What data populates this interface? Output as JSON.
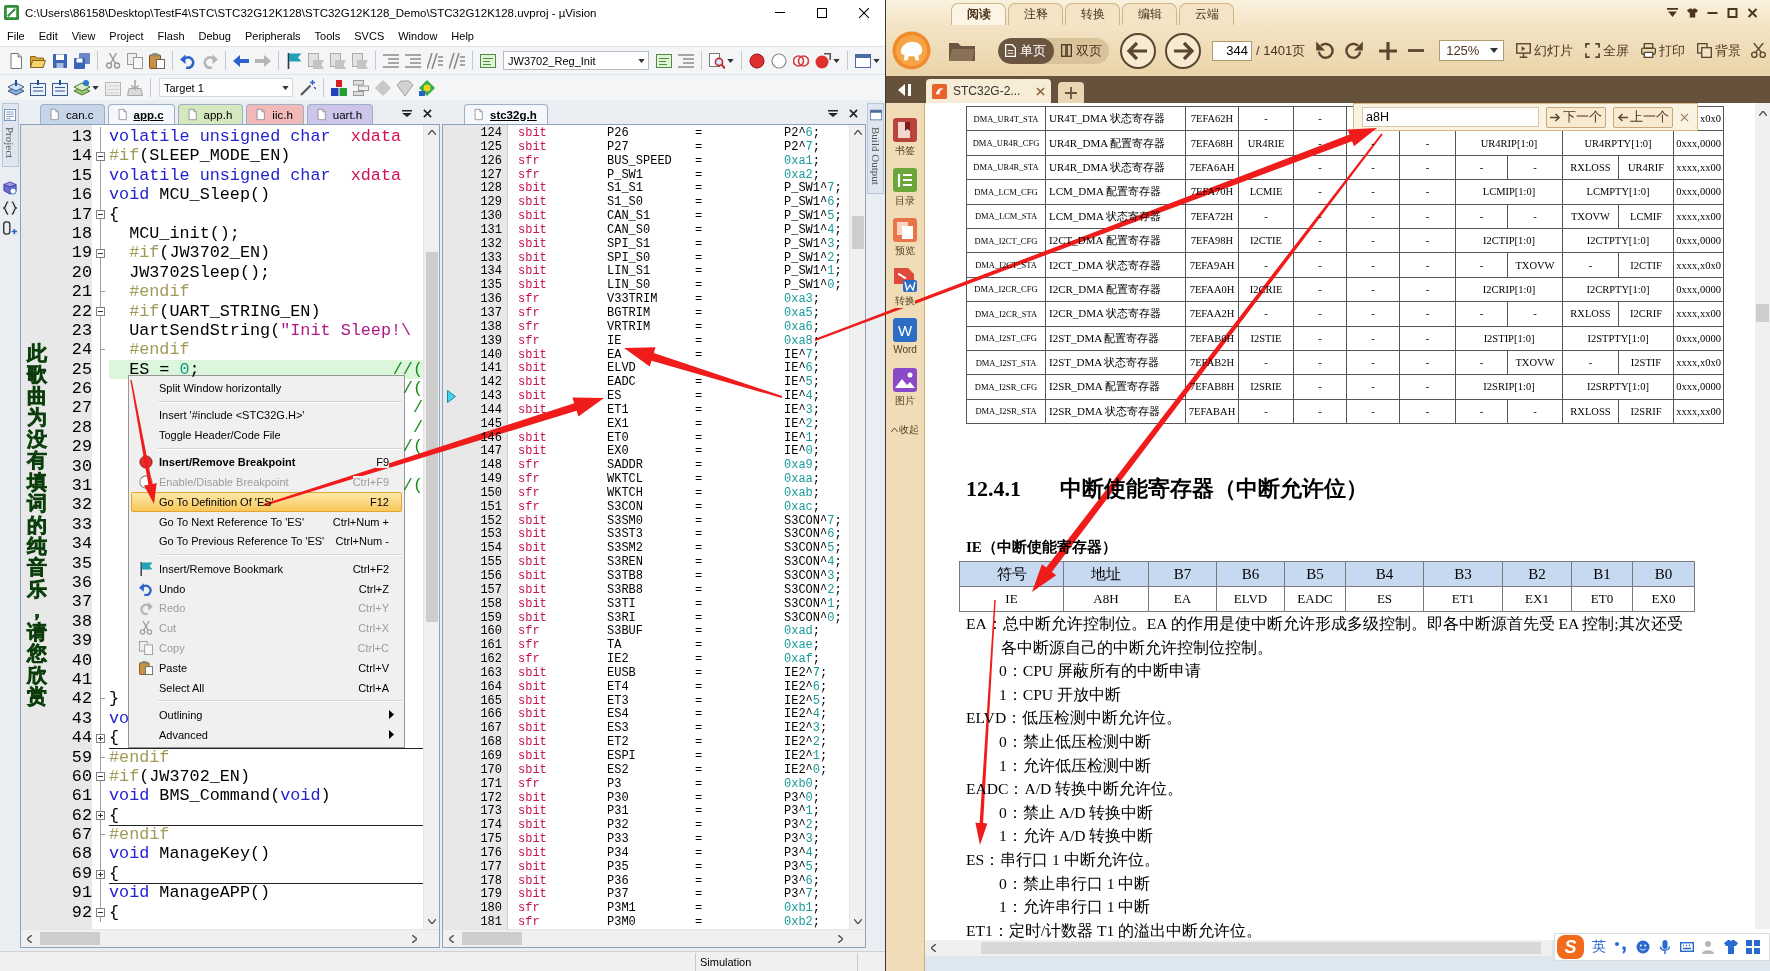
{
  "ide": {
    "title": "C:\\Users\\86158\\Desktop\\TestF4\\STC\\STC32G12K128\\STC32G12K128_Demo\\STC32G12K128.uvproj - µVision",
    "menu": [
      "File",
      "Edit",
      "View",
      "Project",
      "Flash",
      "Debug",
      "Peripherals",
      "Tools",
      "SVCS",
      "Window",
      "Help"
    ],
    "function_combo": "JW3702_Reg_Init",
    "target_combo": "Target 1",
    "project_tab": "Project",
    "build_output_tab": "Build Output",
    "status": "Simulation",
    "editor": {
      "tabs": [
        {
          "label": "can.c",
          "selected": false,
          "color": "#c6d5e8"
        },
        {
          "label": "app.c",
          "selected": true,
          "color": "#f4f7fb"
        },
        {
          "label": "app.h",
          "selected": false,
          "color": "#d3e8bf"
        },
        {
          "label": "iic.h",
          "selected": false,
          "color": "#f2b9b9"
        },
        {
          "label": "uart.h",
          "selected": false,
          "color": "#cdc5ec"
        }
      ],
      "lines": [
        {
          "n": "13",
          "kind": "plain",
          "current": false,
          "code": [
            {
              "kind": "keyword",
              "t": "volatile unsigned char"
            },
            {
              "kind": "storage",
              "t": "  xdata"
            }
          ]
        },
        {
          "n": "14",
          "kind": "fold_open",
          "current": false,
          "code": [
            {
              "kind": "preproc",
              "t": "#if"
            },
            {
              "kind": "plain",
              "t": "(SLEEP_MODE_EN)"
            }
          ]
        },
        {
          "n": "15",
          "kind": "plain",
          "current": false,
          "code": [
            {
              "kind": "keyword",
              "t": "volatile unsigned char"
            },
            {
              "kind": "storage",
              "t": "  xdata"
            }
          ]
        },
        {
          "n": "16",
          "kind": "plain",
          "current": false,
          "code": [
            {
              "kind": "keyword",
              "t": "void"
            },
            {
              "kind": "plain",
              "t": " MCU_Sleep()"
            }
          ]
        },
        {
          "n": "17",
          "kind": "fold_open",
          "current": false,
          "code": [
            {
              "kind": "plain",
              "t": "{"
            }
          ]
        },
        {
          "n": "18",
          "kind": "plain",
          "current": false,
          "code": [
            {
              "kind": "plain",
              "t": "  MCU_init();"
            }
          ]
        },
        {
          "n": "19",
          "kind": "fold_open",
          "current": false,
          "code": [
            {
              "kind": "preproc",
              "t": "  #if"
            },
            {
              "kind": "plain",
              "t": "(JW3702_EN)"
            }
          ]
        },
        {
          "n": "20",
          "kind": "plain",
          "current": false,
          "code": [
            {
              "kind": "plain",
              "t": "  JW3702Sleep();"
            }
          ]
        },
        {
          "n": "21",
          "kind": "fold_end",
          "current": false,
          "code": [
            {
              "kind": "preproc",
              "t": "  #endif"
            }
          ]
        },
        {
          "n": "22",
          "kind": "fold_open",
          "current": false,
          "code": [
            {
              "kind": "preproc",
              "t": "  #if"
            },
            {
              "kind": "plain",
              "t": "(UART_STRING_EN)"
            }
          ]
        },
        {
          "n": "23",
          "kind": "plain",
          "current": false,
          "code": [
            {
              "kind": "plain",
              "t": "  UartSendString("
            },
            {
              "kind": "string",
              "t": "\"Init Sleep!\\"
            }
          ]
        },
        {
          "n": "24",
          "kind": "fold_end",
          "current": false,
          "code": [
            {
              "kind": "preproc",
              "t": "  #endif"
            }
          ]
        },
        {
          "n": "25",
          "kind": "plain",
          "current": true,
          "code": [
            {
              "kind": "plain",
              "t": "  ES = "
            },
            {
              "kind": "number",
              "t": "0"
            },
            {
              "kind": "plain",
              "t": ";"
            }
          ],
          "comment": "//("
        },
        {
          "n": "26",
          "kind": "plain",
          "current": false,
          "comment": "/("
        },
        {
          "n": "27",
          "kind": "plain",
          "current": false,
          "comment": "/"
        },
        {
          "n": "28",
          "kind": "plain",
          "current": false,
          "comment": "/"
        },
        {
          "n": "29",
          "kind": "plain",
          "current": false,
          "comment": "/("
        },
        {
          "n": "30",
          "kind": "plain",
          "current": false
        },
        {
          "n": "31",
          "kind": "plain",
          "current": false,
          "comment": "/("
        },
        {
          "n": "32",
          "kind": "plain",
          "current": false
        },
        {
          "n": "33",
          "kind": "plain",
          "current": false
        },
        {
          "n": "34",
          "kind": "plain",
          "current": false
        },
        {
          "n": "35",
          "kind": "plain",
          "current": false
        },
        {
          "n": "36",
          "kind": "plain",
          "current": false
        },
        {
          "n": "37",
          "kind": "plain",
          "current": false
        },
        {
          "n": "38",
          "kind": "plain",
          "current": false
        },
        {
          "n": "39",
          "kind": "plain",
          "current": false
        },
        {
          "n": "40",
          "kind": "plain",
          "current": false
        },
        {
          "n": "41",
          "kind": "plain",
          "current": false
        },
        {
          "n": "42",
          "kind": "fold_end",
          "current": false,
          "code": [
            {
              "kind": "plain",
              "t": "}"
            }
          ]
        },
        {
          "n": "43",
          "kind": "plain",
          "current": false,
          "code": [
            {
              "kind": "keyword",
              "t": "vo"
            }
          ]
        },
        {
          "n": "44",
          "kind": "fold_closed",
          "current": false,
          "code": [
            {
              "kind": "plain",
              "t": "{"
            }
          ]
        },
        {
          "n": "59",
          "kind": "fold_end",
          "current": false,
          "code": [
            {
              "kind": "preproc",
              "t": "#endif"
            }
          ]
        },
        {
          "n": "60",
          "kind": "fold_open",
          "current": false,
          "code": [
            {
              "kind": "preproc",
              "t": "#if"
            },
            {
              "kind": "plain",
              "t": "(JW3702_EN)"
            }
          ]
        },
        {
          "n": "61",
          "kind": "plain",
          "current": false,
          "code": [
            {
              "kind": "keyword",
              "t": "void"
            },
            {
              "kind": "plain",
              "t": " BMS_Command("
            },
            {
              "kind": "keyword",
              "t": "void"
            },
            {
              "kind": "plain",
              "t": ")"
            }
          ]
        },
        {
          "n": "62",
          "kind": "fold_closed",
          "current": false,
          "code": [
            {
              "kind": "plain",
              "t": "{"
            }
          ]
        },
        {
          "n": "67",
          "kind": "fold_end",
          "current": false,
          "code": [
            {
              "kind": "preproc",
              "t": "#endif"
            }
          ]
        },
        {
          "n": "68",
          "kind": "plain",
          "current": false,
          "code": [
            {
              "kind": "keyword",
              "t": "void"
            },
            {
              "kind": "plain",
              "t": " ManageKey()"
            }
          ]
        },
        {
          "n": "69",
          "kind": "fold_closed",
          "current": false,
          "code": [
            {
              "kind": "plain",
              "t": "{"
            }
          ]
        },
        {
          "n": "91",
          "kind": "plain",
          "current": false,
          "code": [
            {
              "kind": "keyword",
              "t": "void"
            },
            {
              "kind": "plain",
              "t": " ManageAPP()"
            }
          ]
        },
        {
          "n": "92",
          "kind": "fold_open",
          "current": false,
          "code": [
            {
              "kind": "plain",
              "t": "{"
            }
          ]
        }
      ]
    },
    "context_menu": {
      "groups": [
        [
          {
            "label": "Split Window horizontally",
            "disabled": false,
            "selected": false,
            "default": false,
            "submenu": false
          }
        ],
        [
          {
            "label": "Insert '#include <STC32G.H>'",
            "disabled": false,
            "selected": false,
            "default": false,
            "submenu": false
          },
          {
            "label": "Toggle Header/Code File",
            "disabled": false,
            "selected": false,
            "default": false,
            "submenu": false
          }
        ],
        [
          {
            "label": "Insert/Remove Breakpoint",
            "shortcut": "F9",
            "disabled": false,
            "selected": false,
            "default": true,
            "submenu": false
          },
          {
            "label": "Enable/Disable Breakpoint",
            "shortcut": "Ctrl+F9",
            "disabled": true,
            "selected": false,
            "default": false,
            "submenu": false
          },
          {
            "label": "Go To Definition Of 'ES'",
            "shortcut": "F12",
            "disabled": false,
            "selected": true,
            "default": false,
            "submenu": false
          },
          {
            "label": "Go To Next Reference To 'ES'",
            "shortcut": "Ctrl+Num +",
            "disabled": false,
            "selected": false,
            "default": false,
            "submenu": false
          },
          {
            "label": "Go To Previous Reference To 'ES'",
            "shortcut": "Ctrl+Num -",
            "disabled": false,
            "selected": false,
            "default": false,
            "submenu": false
          }
        ],
        [
          {
            "label": "Insert/Remove Bookmark",
            "shortcut": "Ctrl+F2",
            "disabled": false,
            "selected": false,
            "default": false,
            "submenu": false
          },
          {
            "label": "Undo",
            "shortcut": "Ctrl+Z",
            "disabled": false,
            "selected": false,
            "default": false,
            "submenu": false
          },
          {
            "label": "Redo",
            "shortcut": "Ctrl+Y",
            "disabled": true,
            "selected": false,
            "default": false,
            "submenu": false
          },
          {
            "label": "Cut",
            "shortcut": "Ctrl+X",
            "disabled": true,
            "selected": false,
            "default": false,
            "submenu": false
          },
          {
            "label": "Copy",
            "shortcut": "Ctrl+C",
            "disabled": true,
            "selected": false,
            "default": false,
            "submenu": false
          },
          {
            "label": "Paste",
            "shortcut": "Ctrl+V",
            "disabled": false,
            "selected": false,
            "default": false,
            "submenu": false
          },
          {
            "label": "Select All",
            "shortcut": "Ctrl+A",
            "disabled": false,
            "selected": false,
            "default": false,
            "submenu": false
          }
        ],
        [
          {
            "label": "Outlining",
            "disabled": false,
            "selected": false,
            "default": false,
            "submenu": true
          },
          {
            "label": "Advanced",
            "disabled": false,
            "selected": false,
            "default": false,
            "submenu": true
          }
        ]
      ]
    },
    "header_editor": {
      "tabs": [
        {
          "label": "stc32g.h",
          "selected": true
        }
      ],
      "lines": [
        {
          "n": "124",
          "decl": "sbit",
          "name": "P26",
          "op": "=",
          "value": "P2^6;",
          "current": false
        },
        {
          "n": "125",
          "decl": "sbit",
          "name": "P27",
          "op": "=",
          "value": "P2^7;",
          "current": false
        },
        {
          "n": "126",
          "decl": "sfr",
          "name": "BUS_SPEED",
          "op": "=",
          "value": "0xa1;",
          "current": false
        },
        {
          "n": "127",
          "decl": "sfr",
          "name": "P_SW1",
          "op": "=",
          "value": "0xa2;",
          "current": false
        },
        {
          "n": "128",
          "decl": "sbit",
          "name": "S1_S1",
          "op": "=",
          "value": "P_SW1^7;",
          "current": false
        },
        {
          "n": "129",
          "decl": "sbit",
          "name": "S1_S0",
          "op": "=",
          "value": "P_SW1^6;",
          "current": false
        },
        {
          "n": "130",
          "decl": "sbit",
          "name": "CAN_S1",
          "op": "=",
          "value": "P_SW1^5;",
          "current": false
        },
        {
          "n": "131",
          "decl": "sbit",
          "name": "CAN_S0",
          "op": "=",
          "value": "P_SW1^4;",
          "current": false
        },
        {
          "n": "132",
          "decl": "sbit",
          "name": "SPI_S1",
          "op": "=",
          "value": "P_SW1^3;",
          "current": false
        },
        {
          "n": "133",
          "decl": "sbit",
          "name": "SPI_S0",
          "op": "=",
          "value": "P_SW1^2;",
          "current": false
        },
        {
          "n": "134",
          "decl": "sbit",
          "name": "LIN_S1",
          "op": "=",
          "value": "P_SW1^1;",
          "current": false
        },
        {
          "n": "135",
          "decl": "sbit",
          "name": "LIN_S0",
          "op": "=",
          "value": "P_SW1^0;",
          "current": false
        },
        {
          "n": "136",
          "decl": "sfr",
          "name": "V33TRIM",
          "op": "=",
          "value": "0xa3;",
          "current": false
        },
        {
          "n": "137",
          "decl": "sfr",
          "name": "BGTRIM",
          "op": "=",
          "value": "0xa5;",
          "current": false
        },
        {
          "n": "138",
          "decl": "sfr",
          "name": "VRTRIM",
          "op": "=",
          "value": "0xa6;",
          "current": false
        },
        {
          "n": "139",
          "decl": "sfr",
          "name": "IE",
          "op": "=",
          "value": "0xa8;",
          "current": false
        },
        {
          "n": "140",
          "decl": "sbit",
          "name": "EA",
          "op": "=",
          "value": "IE^7;",
          "current": false
        },
        {
          "n": "141",
          "decl": "sbit",
          "name": "ELVD",
          "value": "IE^6;",
          "current": false
        },
        {
          "n": "142",
          "decl": "sbit",
          "name": "EADC",
          "op": "=",
          "value": "IE^5;",
          "current": false
        },
        {
          "n": "143",
          "decl": "sbit",
          "name": "ES",
          "op": "=",
          "value": "IE^4;",
          "current": true
        },
        {
          "n": "144",
          "decl": "sbit",
          "name": "ET1",
          "op": "=",
          "value": "IE^3;",
          "current": false
        },
        {
          "n": "145",
          "name": "EX1",
          "op": "=",
          "value": "IE^2;",
          "current": false
        },
        {
          "n": "146",
          "decl": "sbit",
          "name": "ET0",
          "op": "=",
          "value": "IE^1;",
          "current": false
        },
        {
          "n": "147",
          "decl": "sbit",
          "name": "EX0",
          "op": "=",
          "value": "IE^0;",
          "current": false
        },
        {
          "n": "148",
          "decl": "sfr",
          "name": "SADDR",
          "op": "=",
          "value": "0xa9;",
          "current": false
        },
        {
          "n": "149",
          "decl": "sfr",
          "name": "WKTCL",
          "op": "=",
          "value": "0xaa;",
          "current": false
        },
        {
          "n": "150",
          "decl": "sfr",
          "name": "WKTCH",
          "op": "=",
          "value": "0xab;",
          "current": false
        },
        {
          "n": "151",
          "decl": "sfr",
          "name": "S3CON",
          "op": "=",
          "value": "0xac;",
          "current": false
        },
        {
          "n": "152",
          "decl": "sbit",
          "name": "S3SM0",
          "op": "=",
          "value": "S3CON^7;",
          "current": false
        },
        {
          "n": "153",
          "decl": "sbit",
          "name": "S3ST3",
          "op": "=",
          "value": "S3CON^6;",
          "current": false
        },
        {
          "n": "154",
          "decl": "sbit",
          "name": "S3SM2",
          "op": "=",
          "value": "S3CON^5;",
          "current": false
        },
        {
          "n": "155",
          "decl": "sbit",
          "name": "S3REN",
          "op": "=",
          "value": "S3CON^4;",
          "current": false
        },
        {
          "n": "156",
          "decl": "sbit",
          "name": "S3TB8",
          "op": "=",
          "value": "S3CON^3;",
          "current": false
        },
        {
          "n": "157",
          "decl": "sbit",
          "name": "S3RB8",
          "op": "=",
          "value": "S3CON^2;",
          "current": false
        },
        {
          "n": "158",
          "decl": "sbit",
          "name": "S3TI",
          "op": "=",
          "value": "S3CON^1;",
          "current": false
        },
        {
          "n": "159",
          "decl": "sbit",
          "name": "S3RI",
          "op": "=",
          "value": "S3CON^0;",
          "current": false
        },
        {
          "n": "160",
          "decl": "sfr",
          "name": "S3BUF",
          "op": "=",
          "value": "0xad;",
          "current": false
        },
        {
          "n": "161",
          "decl": "sfr",
          "name": "TA",
          "op": "=",
          "value": "0xae;",
          "current": false
        },
        {
          "n": "162",
          "decl": "sfr",
          "name": "IE2",
          "op": "=",
          "value": "0xaf;",
          "current": false
        },
        {
          "n": "163",
          "decl": "sbit",
          "name": "EUSB",
          "op": "=",
          "value": "IE2^7;",
          "current": false
        },
        {
          "n": "164",
          "decl": "sbit",
          "name": "ET4",
          "op": "=",
          "value": "IE2^6;",
          "current": false
        },
        {
          "n": "165",
          "decl": "sbit",
          "name": "ET3",
          "op": "=",
          "value": "IE2^5;",
          "current": false
        },
        {
          "n": "166",
          "decl": "sbit",
          "name": "ES4",
          "op": "=",
          "value": "IE2^4;",
          "current": false
        },
        {
          "n": "167",
          "decl": "sbit",
          "name": "ES3",
          "op": "=",
          "value": "IE2^3;",
          "current": false
        },
        {
          "n": "168",
          "decl": "sbit",
          "name": "ET2",
          "op": "=",
          "value": "IE2^2;",
          "current": false
        },
        {
          "n": "169",
          "decl": "sbit",
          "name": "ESPI",
          "op": "=",
          "value": "IE2^1;",
          "current": false
        },
        {
          "n": "170",
          "decl": "sbit",
          "name": "ES2",
          "op": "=",
          "value": "IE2^0;",
          "current": false
        },
        {
          "n": "171",
          "decl": "sfr",
          "name": "P3",
          "op": "=",
          "value": "0xb0;",
          "current": false
        },
        {
          "n": "172",
          "decl": "sbit",
          "name": "P30",
          "op": "=",
          "value": "P3^0;",
          "current": false
        },
        {
          "n": "173",
          "decl": "sbit",
          "name": "P31",
          "op": "=",
          "value": "P3^1;",
          "current": false
        },
        {
          "n": "174",
          "decl": "sbit",
          "name": "P32",
          "op": "=",
          "value": "P3^2;",
          "current": false
        },
        {
          "n": "175",
          "decl": "sbit",
          "name": "P33",
          "op": "=",
          "value": "P3^3;",
          "current": false
        },
        {
          "n": "176",
          "decl": "sbit",
          "name": "P34",
          "op": "=",
          "value": "P3^4;",
          "current": false
        },
        {
          "n": "177",
          "decl": "sbit",
          "name": "P35",
          "op": "=",
          "value": "P3^5;",
          "current": false
        },
        {
          "n": "178",
          "decl": "sbit",
          "name": "P36",
          "op": "=",
          "value": "P3^6;",
          "current": false
        },
        {
          "n": "179",
          "decl": "sbit",
          "name": "P37",
          "op": "=",
          "value": "P3^7;",
          "current": false
        },
        {
          "n": "180",
          "decl": "sfr",
          "name": "P3M1",
          "op": "=",
          "value": "0xb1;",
          "current": false
        },
        {
          "n": "181",
          "decl": "sfr",
          "name": "P3M0",
          "op": "=",
          "value": "0xb2;",
          "current": false
        }
      ]
    }
  },
  "lyrics": "此歌曲为没有填词的纯音乐，请您欣赏",
  "pdf": {
    "menu_tabs": [
      {
        "label": "阅读",
        "selected": true
      },
      {
        "label": "注释",
        "selected": false
      },
      {
        "label": "转换",
        "selected": false
      },
      {
        "label": "编辑",
        "selected": false
      },
      {
        "label": "云端",
        "selected": false
      }
    ],
    "view_modes": [
      {
        "label": "单页",
        "selected": true
      },
      {
        "label": "双页",
        "selected": false
      }
    ],
    "page": {
      "value": "344",
      "total": "/ 1401页"
    },
    "zoom": "125%",
    "tools": [
      "幻灯片",
      "全屏",
      "打印",
      "背景"
    ],
    "doc_tab": "STC32G-2...",
    "sidebar": [
      {
        "label": "书签"
      },
      {
        "label": "目录"
      },
      {
        "label": "预览"
      },
      {
        "label": "转换"
      },
      {
        "label": "Word",
        "badge": "W"
      },
      {
        "label": "图片"
      },
      {
        "label": "收起"
      }
    ],
    "search": {
      "value": "a8H",
      "next": "下一个",
      "previous": "上一个"
    },
    "dma_rows": [
      [
        "DMA_UR4T_STA",
        "UR4T_DMA 状态寄存器",
        "7EFA62H",
        "-",
        "-",
        "x0x0"
      ],
      [
        "DMA_UR4R_CFG",
        "UR4R_DMA 配置寄存器",
        "7EFA68H",
        "UR4RIE",
        "-",
        "-",
        "-",
        {
          "text": "UR4RIP[1:0]",
          "kind": "pair"
        },
        {
          "text": "UR4RPTY[1:0]",
          "kind": "pair"
        },
        "0xxx,0000"
      ],
      [
        "DMA_UR4R_STA",
        "UR4R_DMA 状态寄存器",
        "7EFA6AH",
        null,
        "-",
        "-",
        "-",
        "-",
        "-",
        "RXLOSS",
        "UR4RIF",
        "xxxx,xx00"
      ],
      [
        "DMA_LCM_CFG",
        "LCM_DMA 配置寄存器",
        "7EFA70H",
        "LCMIE",
        "-",
        "-",
        "-",
        {
          "text": "LCMIP[1:0]",
          "kind": "pair"
        },
        {
          "text": "LCMPTY[1:0]",
          "kind": "pair"
        },
        "0xxx,0000"
      ],
      [
        "DMA_LCM_STA",
        "LCM_DMA 状态寄存器",
        "7EFA72H",
        "-",
        "-",
        "-",
        "-",
        "-",
        "-",
        "TXOVW",
        "LCMIF",
        "xxxx,xx00"
      ],
      [
        "DMA_I2CT_CFG",
        "I2CT_DMA 配置寄存器",
        "7EFA98H",
        "I2CTIE",
        "-",
        "-",
        "-",
        {
          "text": "I2CTIP[1:0]",
          "kind": "pair"
        },
        {
          "text": "I2CTPTY[1:0]",
          "kind": "pair"
        },
        "0xxx,0000"
      ],
      [
        "DMA_I2CT_STA",
        "I2CT_DMA 状态寄存器",
        "7EFA9AH",
        "-",
        "-",
        "-",
        "-",
        "-",
        "TXOVW",
        "-",
        "I2CTIF",
        "xxxx,x0x0"
      ],
      [
        "DMA_I2CR_CFG",
        "I2CR_DMA 配置寄存器",
        "7EFAA0H",
        "I2CRIE",
        "-",
        "-",
        "-",
        {
          "text": "I2CRIP[1:0]",
          "kind": "pair"
        },
        {
          "text": "I2CRPTY[1:0]",
          "kind": "pair"
        },
        "0xxx,0000"
      ],
      [
        "DMA_I2CR_STA",
        "I2CR_DMA 状态寄存器",
        "7EFAA2H",
        "-",
        "-",
        "-",
        "-",
        "-",
        "-",
        "RXLOSS",
        "I2CRIF",
        "xxxx,xx00"
      ],
      [
        "DMA_I2ST_CFG",
        "I2ST_DMA 配置寄存器",
        "7EFAB0H",
        "I2STIE",
        "-",
        "-",
        "-",
        {
          "text": "I2STIP[1:0]",
          "kind": "pair"
        },
        {
          "text": "I2STPTY[1:0]",
          "kind": "pair"
        },
        "0xxx,0000"
      ],
      [
        "DMA_I2ST_STA",
        "I2ST_DMA 状态寄存器",
        "7EFAB2H",
        "-",
        "-",
        "-",
        "-",
        "-",
        "TXOVW",
        "-",
        "I2STIF",
        "xxxx,x0x0"
      ],
      [
        "DMA_I2SR_CFG",
        "I2SR_DMA 配置寄存器",
        "7EFAB8H",
        "I2SRIE",
        "-",
        "-",
        "-",
        {
          "text": "I2SRIP[1:0]",
          "kind": "pair"
        },
        {
          "text": "I2SRPTY[1:0]",
          "kind": "pair"
        },
        "0xxx,0000"
      ],
      [
        "DMA_I2SR_STA",
        "I2SR_DMA 状态寄存器",
        "7EFABAH",
        "-",
        "-",
        "-",
        "-",
        "-",
        "-",
        "RXLOSS",
        "I2SRIF",
        "xxxx,xx00"
      ]
    ],
    "section": {
      "number": "12.4.1",
      "title": "中断使能寄存器（中断允许位）"
    },
    "register": {
      "caption": "IE（中断使能寄存器）",
      "columns": [
        "符号",
        "地址",
        "B7",
        "B6",
        "B5",
        "B4",
        "B3",
        "B2",
        "B1",
        "B0"
      ],
      "rows": [
        [
          "IE",
          "A8H",
          "EA",
          "ELVD",
          "EADC",
          "ES",
          "ET1",
          "EX1",
          "ET0",
          "EX0"
        ]
      ]
    },
    "bits": [
      {
        "lines": [
          "EA：总中断允许控制位。EA 的作用是使中断允许形成多级控制。即各中断源首先受 EA 控制;其次还受",
          "各中断源自己的中断允许控制位控制。"
        ],
        "options": [
          "0：CPU 屏蔽所有的中断申请",
          "1：CPU 开放中断"
        ]
      },
      {
        "lines": [
          "ELVD：低压检测中断允许位。"
        ],
        "options": [
          "0：禁止低压检测中断",
          "1：允许低压检测中断"
        ]
      },
      {
        "lines": [
          "EADC：A/D 转换中断允许位。"
        ],
        "options": [
          "0：禁止 A/D 转换中断",
          "1：允许 A/D 转换中断"
        ]
      },
      {
        "lines": [
          "ES：串行口 1 中断允许位。"
        ],
        "options": [
          "0：禁止串行口 1 中断",
          "1：允许串行口 1 中断"
        ]
      },
      {
        "lines": [
          "ET1：定时/计数器 T1 的溢出中断允许位。"
        ]
      }
    ]
  },
  "ime": {
    "logo": "S",
    "mode": "英"
  }
}
